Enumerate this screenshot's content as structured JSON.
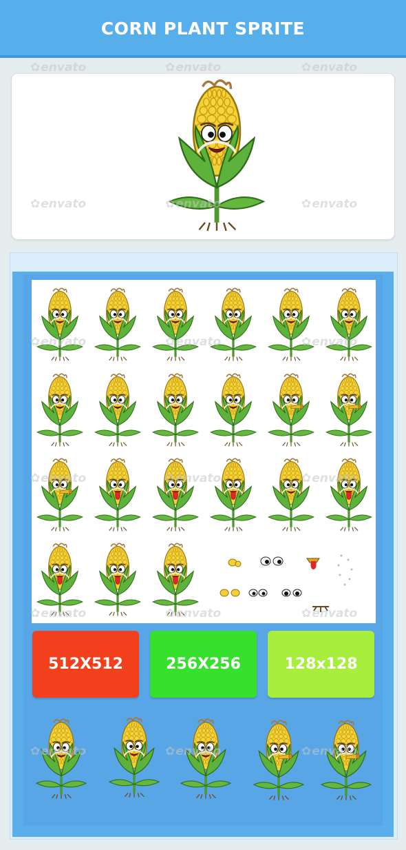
{
  "header": {
    "title": "CORN PLANT SPRITE"
  },
  "watermark": {
    "text": "envato"
  },
  "sizes": [
    {
      "label": "512X512",
      "color": "#f2401c"
    },
    {
      "label": "256X256",
      "color": "#37e02d"
    },
    {
      "label": "128x128",
      "color": "#a8ee3c"
    }
  ],
  "palette": {
    "header": "#56aeea",
    "panel": "#5aaeec",
    "kernel": "#f2d235",
    "leaf": "#5cb23a",
    "tongue": "#e0272b"
  }
}
